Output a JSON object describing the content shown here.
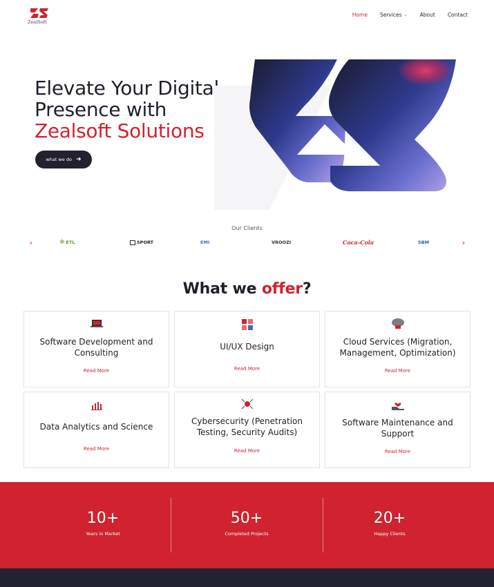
{
  "brand": {
    "name": "ZealSoft",
    "accent": "#d0232f",
    "dark": "#22222f"
  },
  "nav": {
    "items": [
      {
        "label": "Home",
        "active": true
      },
      {
        "label": "Services",
        "has_dropdown": true
      },
      {
        "label": "About"
      },
      {
        "label": "Contact"
      }
    ],
    "dropdown_icon": "chevron-down-icon"
  },
  "hero": {
    "line1": "Elevate Your Digital",
    "line2": "Presence with",
    "line3": "Zealsoft Solutions",
    "cta_label": "what we do",
    "cta_icon": "arrow-right-icon"
  },
  "clients": {
    "title": "Our Clients",
    "logos": [
      {
        "name": "ETL",
        "color": "#5a9a2e"
      },
      {
        "name": "SPORT",
        "color": "#222222"
      },
      {
        "name": "EMI",
        "color": "#3b6fc9"
      },
      {
        "name": "VROOZI",
        "color": "#333333"
      },
      {
        "name": "Coca-Cola",
        "color": "#d0232f"
      },
      {
        "name": "SBM",
        "color": "#1e5fb3"
      }
    ],
    "prev_icon": "chevron-left-icon",
    "next_icon": "chevron-right-icon"
  },
  "offer": {
    "heading_main": "What we ",
    "heading_accent": "offer",
    "heading_end": "?",
    "cards": [
      {
        "title": "Software Development and Consulting",
        "link": "Read More",
        "icon": "laptop-icon"
      },
      {
        "title": "UI/UX Design",
        "link": "Read More",
        "icon": "layout-blocks-icon"
      },
      {
        "title": "Cloud Services (Migration, Management, Optimization)",
        "link": "Read More",
        "icon": "cloud-icon"
      },
      {
        "title": "Data Analytics and Science",
        "link": "Read More",
        "icon": "bar-chart-icon"
      },
      {
        "title": "Cybersecurity (Penetration Testing, Security Audits)",
        "link": "Read More",
        "icon": "virus-shield-icon"
      },
      {
        "title": "Software Maintenance and Support",
        "link": "Read More",
        "icon": "hand-heart-icon"
      }
    ]
  },
  "stats": [
    {
      "value": "10+",
      "label": "Years in Market"
    },
    {
      "value": "50+",
      "label": "Completed Projects"
    },
    {
      "value": "20+",
      "label": "Happy Clients"
    }
  ]
}
